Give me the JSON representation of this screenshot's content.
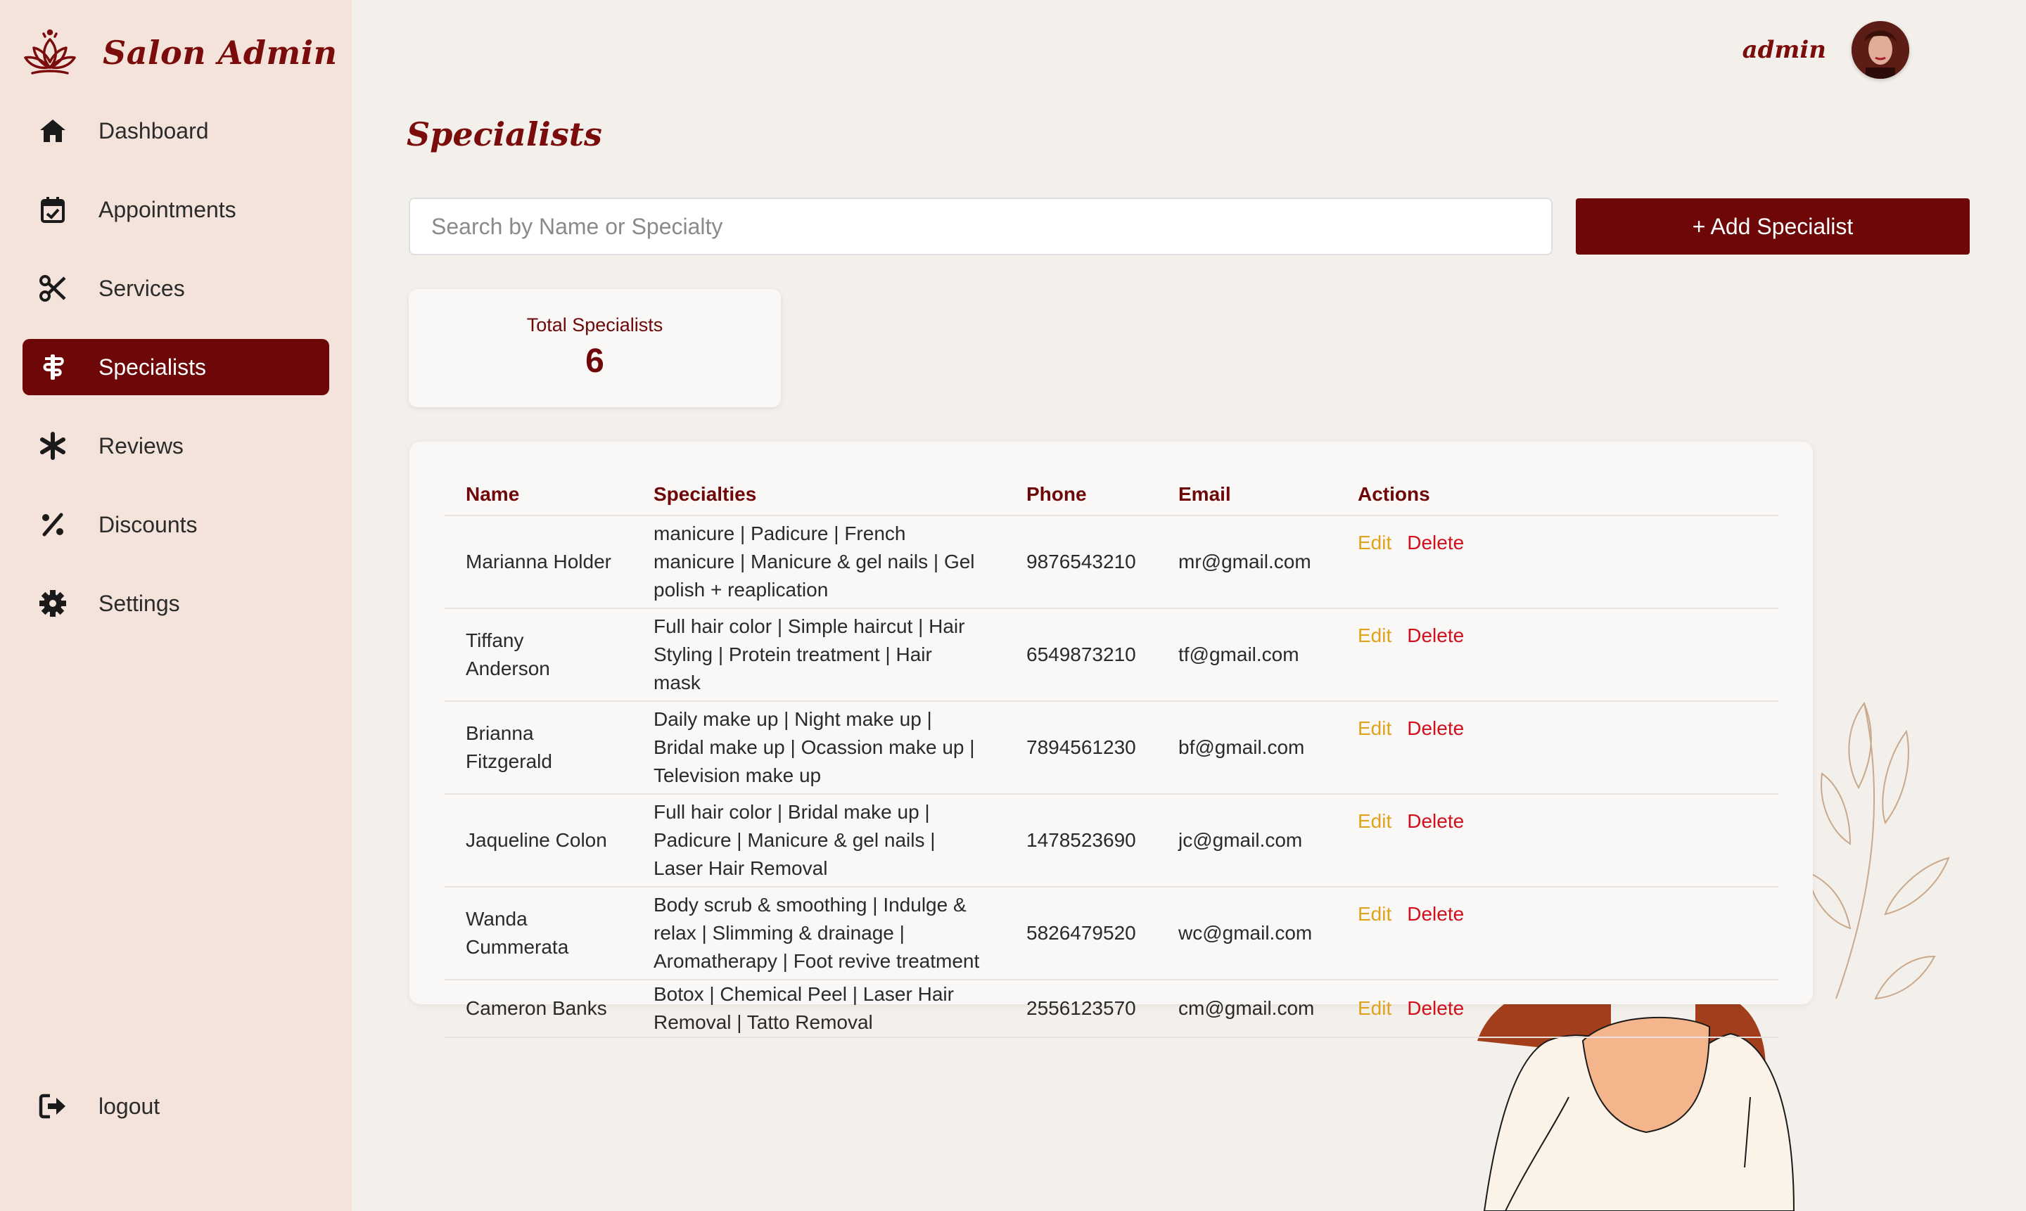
{
  "brand": {
    "title": "Salon Admin"
  },
  "nav": {
    "items": [
      {
        "label": "Dashboard",
        "icon": "home-icon",
        "active": false
      },
      {
        "label": "Appointments",
        "icon": "calendar-check-icon",
        "active": false
      },
      {
        "label": "Services",
        "icon": "scissors-icon",
        "active": false
      },
      {
        "label": "Specialists",
        "icon": "staff-of-snake-icon",
        "active": true
      },
      {
        "label": "Reviews",
        "icon": "asterisk-icon",
        "active": false
      },
      {
        "label": "Discounts",
        "icon": "percent-icon",
        "active": false
      },
      {
        "label": "Settings",
        "icon": "gear-icon",
        "active": false
      }
    ],
    "logout_label": "logout"
  },
  "header": {
    "user_name": "admin"
  },
  "page": {
    "title": "Specialists",
    "search_placeholder": "Search by Name or Specialty",
    "search_value": "",
    "add_button_label": "+ Add Specialist"
  },
  "stats": {
    "total_label": "Total Specialists",
    "total_value": "6"
  },
  "table": {
    "headers": {
      "name": "Name",
      "specialties": "Specialties",
      "phone": "Phone",
      "email": "Email",
      "actions": "Actions"
    },
    "edit_label": "Edit",
    "delete_label": "Delete",
    "rows": [
      {
        "name": "Marianna Holder",
        "specialties": "manicure | Padicure | French manicure | Manicure & gel nails | Gel polish + reaplication",
        "phone": "9876543210",
        "email": "mr@gmail.com"
      },
      {
        "name": "Tiffany Anderson",
        "specialties": "Full hair color | Simple haircut | Hair Styling | Protein treatment | Hair mask",
        "phone": "6549873210",
        "email": "tf@gmail.com"
      },
      {
        "name": "Brianna Fitzgerald",
        "specialties": "Daily make up | Night make up | Bridal make up | Ocassion make up | Television make up",
        "phone": "7894561230",
        "email": "bf@gmail.com"
      },
      {
        "name": "Jaqueline Colon",
        "specialties": "Full hair color | Bridal make up | Padicure | Manicure & gel nails | Laser Hair Removal",
        "phone": "1478523690",
        "email": "jc@gmail.com"
      },
      {
        "name": "Wanda Cummerata",
        "specialties": "Body scrub & smoothing | Indulge & relax | Slimming & drainage | Aromatherapy | Foot revive treatment",
        "phone": "5826479520",
        "email": "wc@gmail.com"
      },
      {
        "name": "Cameron Banks",
        "specialties": "Botox | Chemical Peel | Laser Hair Removal | Tatto Removal",
        "phone": "2556123570",
        "email": "cm@gmail.com"
      }
    ]
  },
  "colors": {
    "primary": "#6e0707",
    "sidebar_bg": "#f4e3da",
    "page_bg": "#f3efea",
    "edit": "#e0a31c",
    "delete": "#d0101c"
  }
}
